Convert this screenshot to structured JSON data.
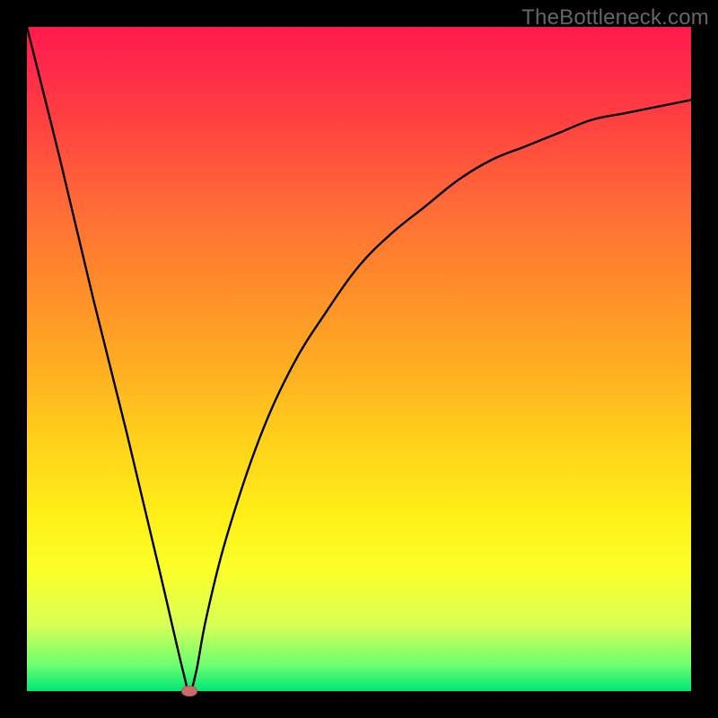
{
  "watermark": "TheBottleneck.com",
  "colors": {
    "background": "#000000",
    "marker": "#cf6a6a",
    "curve_stroke": "#000000"
  },
  "chart_data": {
    "type": "line",
    "title": "",
    "xlabel": "",
    "ylabel": "",
    "xlim": [
      0,
      100
    ],
    "ylim": [
      0,
      100
    ],
    "grid": false,
    "legend": false,
    "series": [
      {
        "name": "bottleneck-curve",
        "x": [
          0,
          5,
          10,
          15,
          20,
          23.5,
          24.5,
          25.5,
          27,
          30,
          35,
          40,
          45,
          50,
          55,
          60,
          65,
          70,
          75,
          80,
          85,
          90,
          95,
          100
        ],
        "values": [
          100,
          80,
          59,
          39,
          18,
          3,
          0,
          3,
          11,
          23,
          38,
          49,
          57,
          64,
          69,
          73,
          77,
          80,
          82,
          84,
          86,
          87,
          88,
          89
        ]
      }
    ],
    "marker": {
      "x": 24.5,
      "y": 0
    }
  }
}
